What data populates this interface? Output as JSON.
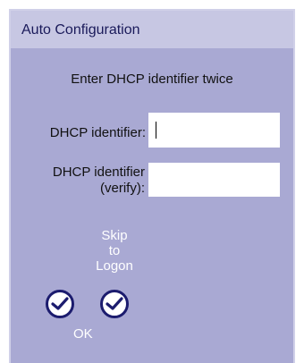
{
  "dialog": {
    "title": "Auto Configuration",
    "instruction": "Enter DHCP identifier twice"
  },
  "fields": {
    "identifier": {
      "label": "DHCP identifier:",
      "value": ""
    },
    "verify": {
      "label_line1": "DHCP identifier",
      "label_line2": "(verify):",
      "value": ""
    }
  },
  "buttons": {
    "skip_line1": "Skip",
    "skip_line2": "to",
    "skip_line3": "Logon",
    "ok": "OK"
  },
  "colors": {
    "dialog_bg": "#a9a9d3",
    "titlebar_bg": "#c7c7e3",
    "button_ring": "#1c1c6e"
  }
}
